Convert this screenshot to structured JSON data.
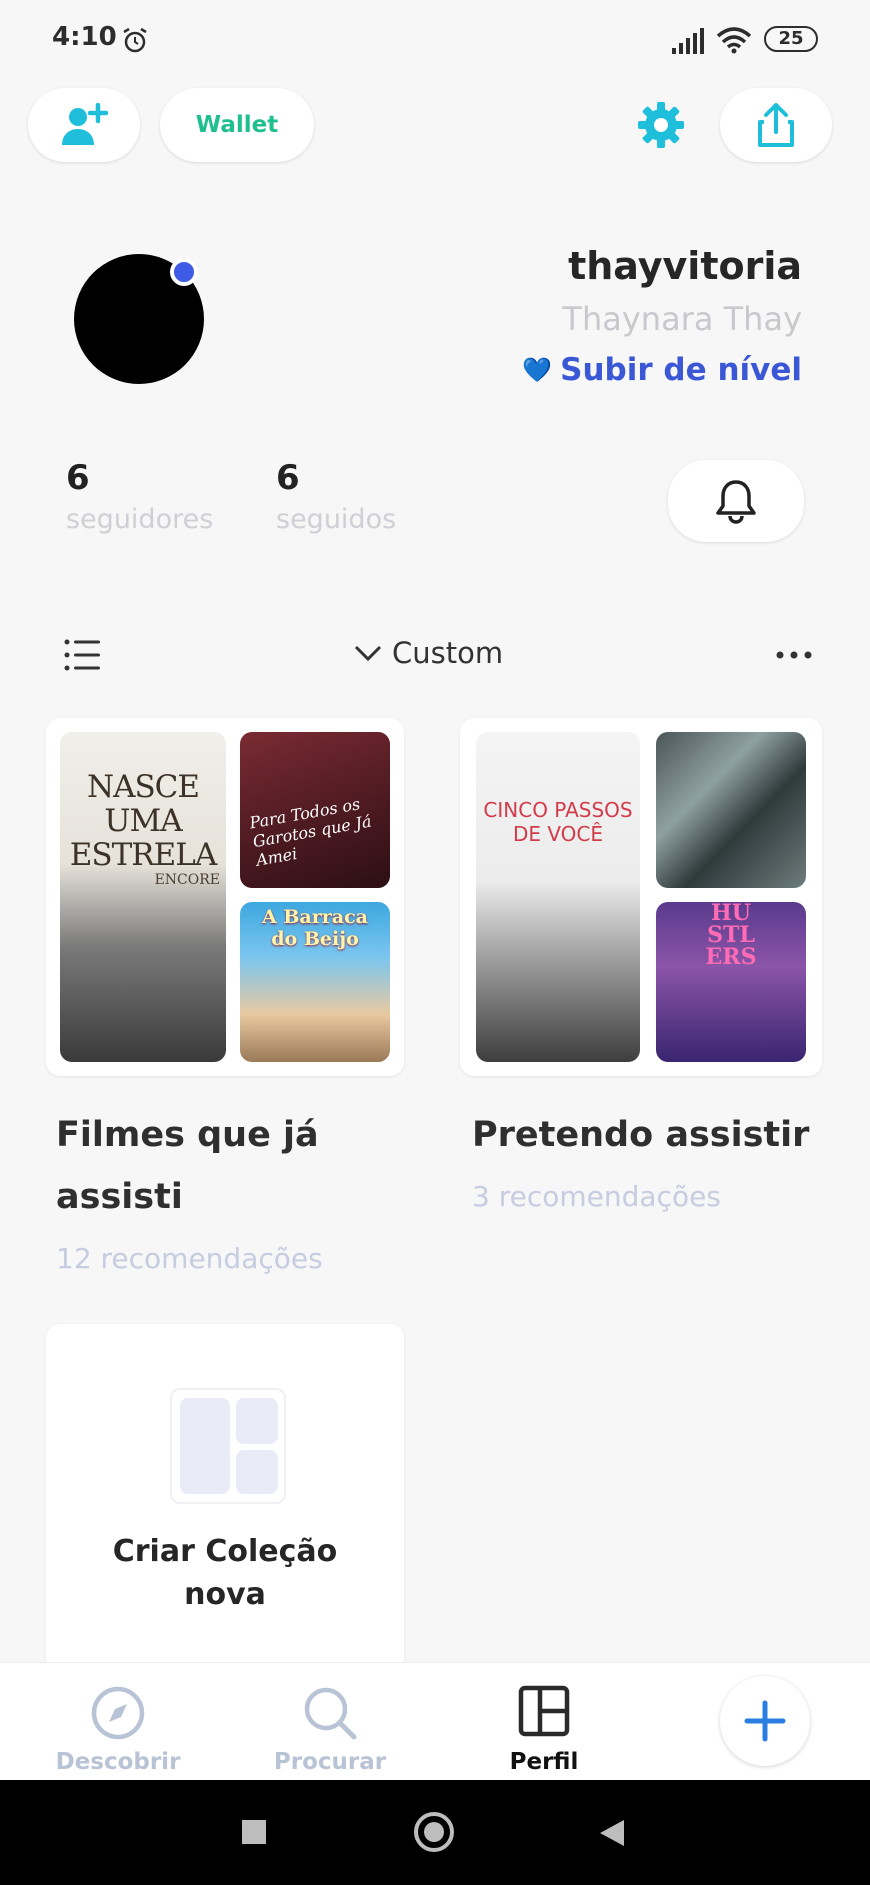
{
  "status_bar": {
    "time": "4:10",
    "battery": "25"
  },
  "top_bar": {
    "wallet_label": "Wallet",
    "icons": [
      "add-user-icon",
      "gear-icon",
      "share-icon"
    ],
    "accent": "#1fbfdc"
  },
  "profile": {
    "username": "thayvitoria",
    "full_name": "Thaynara Thay",
    "level_up": "Subir de nível",
    "level_icon": "💙",
    "followers_count": "6",
    "followers_label": "seguidores",
    "following_count": "6",
    "following_label": "seguidos"
  },
  "collections_header": {
    "sort_label": "Custom"
  },
  "collections": [
    {
      "title": "Filmes que já assisti",
      "count": "12 recomendações",
      "posters": [
        {
          "text": "NASCE UMA ESTRELA",
          "sub": "ENCORE"
        },
        {
          "text": "Para Todos os Garotos que Já Amei"
        },
        {
          "text": "A Barraca do Beijo"
        }
      ]
    },
    {
      "title": "Pretendo assistir",
      "count": "3 recomendações",
      "posters": [
        {
          "text": "CINCO PASSOS DE VOCÊ"
        },
        {
          "text": ""
        },
        {
          "text": "HUSTLERS"
        }
      ]
    }
  ],
  "create_collection": {
    "label": "Criar Coleção nova"
  },
  "bottom_nav": {
    "items": [
      {
        "label": "Descobrir",
        "icon": "compass-icon",
        "active": false
      },
      {
        "label": "Procurar",
        "icon": "search-icon",
        "active": false
      },
      {
        "label": "Perfil",
        "icon": "layout-icon",
        "active": true
      }
    ],
    "fab_icon": "plus-icon"
  },
  "colors": {
    "accent": "#1fbfdc",
    "wallet": "#1fbf8f",
    "level": "#3a57d6",
    "inactive_nav": "#b9c3d6"
  }
}
